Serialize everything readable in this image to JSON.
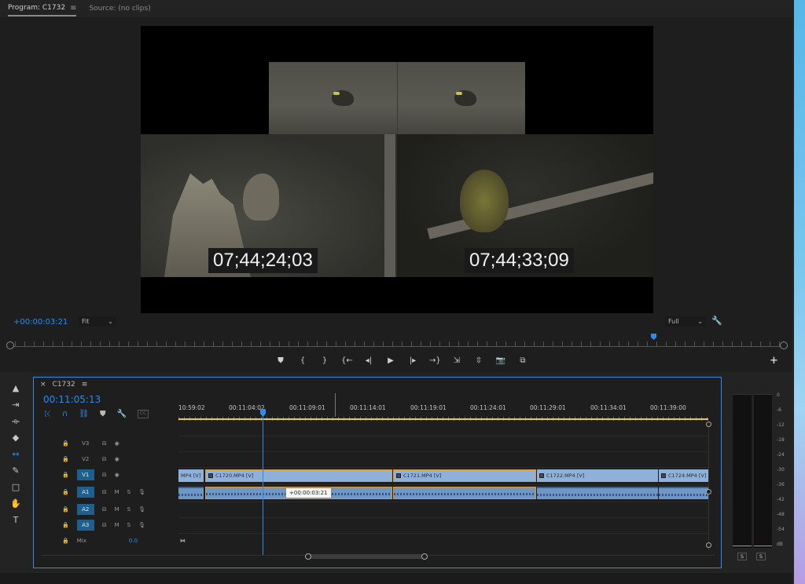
{
  "program_monitor": {
    "tabs": [
      {
        "label": "Program: C1732"
      },
      {
        "label": "Source: (no clips)"
      }
    ],
    "menu_glyph": "≡",
    "timecode_overlays": [
      "07;44;24;03",
      "07;44;33;09"
    ],
    "offset_timecode": "+00:00:03:21",
    "fit": {
      "value": "Fit",
      "caret": "⌄"
    },
    "full": {
      "value": "Full",
      "caret": "⌄"
    },
    "wrench": "🔧",
    "transport": {
      "marker": "⛊",
      "mark_in": "{",
      "mark_out": "}",
      "go_in": "{←",
      "step_back": "◂|",
      "play": "▶",
      "step_forward": "|▸",
      "go_out": "→}",
      "insert": "⇲",
      "overwrite": "⇳",
      "export_frame": "📷",
      "compare": "⧉"
    },
    "plus": "+"
  },
  "tools": [
    {
      "name": "selection-tool",
      "glyph": "▲",
      "active": false
    },
    {
      "name": "track-select-tool",
      "glyph": "⇥",
      "active": false
    },
    {
      "name": "ripple-edit-tool",
      "glyph": "⟛",
      "active": false
    },
    {
      "name": "razor-tool",
      "glyph": "◆",
      "active": false
    },
    {
      "name": "slip-tool",
      "glyph": "↔",
      "active": true
    },
    {
      "name": "pen-tool",
      "glyph": "✎",
      "active": false
    },
    {
      "name": "rectangle-tool",
      "glyph": "□",
      "active": false
    },
    {
      "name": "hand-tool",
      "glyph": "✋",
      "active": false
    },
    {
      "name": "type-tool",
      "glyph": "T",
      "active": false
    }
  ],
  "timeline": {
    "close": "×",
    "sequence_name": "C1732",
    "menu_glyph": "≡",
    "current_timecode": "00:11:05:13",
    "toolbar": {
      "nest": "⤪",
      "snap": "∩",
      "linked": "⛓",
      "marker": "⛊",
      "settings": "🔧",
      "cc": "CC"
    },
    "ruler_labels": [
      "10:59:02",
      "00:11:04:02",
      "00:11:09:01",
      "00:11:14:01",
      "00:11:19:01",
      "00:11:24:01",
      "00:11:29:01",
      "00:11:34:01",
      "00:11:39:00"
    ],
    "tracks": [
      {
        "id": "V3",
        "type": "video",
        "label": "V3",
        "lock": "🔒",
        "sync": "⊟",
        "eye": "◉",
        "selected": false
      },
      {
        "id": "V2",
        "type": "video",
        "label": "V2",
        "lock": "🔒",
        "sync": "⊟",
        "eye": "◉",
        "selected": false
      },
      {
        "id": "V1",
        "type": "video",
        "label": "V1",
        "lock": "🔒",
        "sync": "⊟",
        "eye": "◉",
        "selected": true
      },
      {
        "id": "A1",
        "type": "audio",
        "label": "A1",
        "lock": "🔒",
        "sync": "⊟",
        "m": "M",
        "s": "S",
        "mic": "🎙",
        "selected": true
      },
      {
        "id": "A2",
        "type": "audio",
        "label": "A2",
        "lock": "🔒",
        "sync": "⊟",
        "m": "M",
        "s": "S",
        "mic": "🎙",
        "selected": true
      },
      {
        "id": "A3",
        "type": "audio",
        "label": "A3",
        "lock": "🔒",
        "sync": "⊟",
        "m": "M",
        "s": "S",
        "mic": "🎙",
        "selected": true
      }
    ],
    "mix": {
      "lock": "🔒",
      "label": "Mix",
      "value": "0.0",
      "end": "⧓"
    },
    "video_clips": [
      {
        "label": "MP4 [V]"
      },
      {
        "label": "C1720.MP4 [V]"
      },
      {
        "label": "C1721.MP4 [V]"
      },
      {
        "label": "C1722.MP4 [V]"
      },
      {
        "label": "C1724.MP4 [V]"
      }
    ],
    "tooltip": "+00:00:03:21"
  },
  "audio_meter": {
    "scale": [
      "0",
      "-6",
      "-12",
      "-18",
      "-24",
      "-30",
      "-36",
      "-42",
      "-48",
      "-54",
      "dB"
    ],
    "solo_left": "S",
    "solo_right": "S"
  }
}
